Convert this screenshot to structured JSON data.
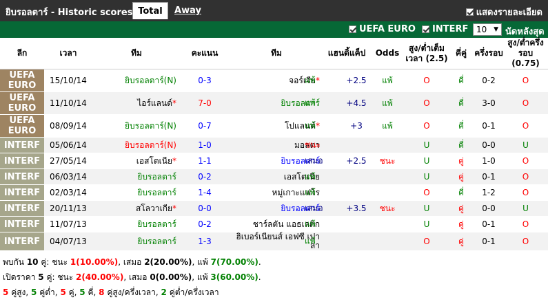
{
  "header": {
    "title": "ยิบรอลตาร์ - Historic scores",
    "tabs": {
      "total": "Total",
      "away": "Away"
    },
    "show_all_label": "แสดงรายละเอียด"
  },
  "filters": {
    "euro_label": "UEFA EURO",
    "interf_label": "INTERF",
    "count_value": "10",
    "last_label": "นัดหลังสุด"
  },
  "columns": {
    "league": "ลีก",
    "time": "เวลา",
    "home": "ทีม",
    "score": "คะแนน",
    "away": "ทีม",
    "handicap": "แฮนดิ้แค็ป",
    "odds": "Odds",
    "ou_half": "สูง/ต่ำเต็มเวลา (2.5)",
    "odd_even": "คี่คู่",
    "half": "ครึ่งรอบ",
    "ou_half2": "สูง/ต่ำครึ่งรอบ (0.75)"
  },
  "rows": [
    {
      "league": "UEFA EURO",
      "date": "15/10/14",
      "home": "ยิบรอลตาร์(N)",
      "home_color": "green",
      "home_star": false,
      "score": "0-3",
      "score_color": "blue",
      "away": "จอร์เจีย",
      "away_color": "black",
      "away_star": true,
      "result": "แพ้",
      "result_color": "green",
      "handicap": "+2.5",
      "odds": "แพ้",
      "odds_color": "green",
      "ou": "O",
      "ou_color": "red",
      "oe": "คี่",
      "oe_color": "green",
      "half": "0-2",
      "hou": "O",
      "hou_color": "red"
    },
    {
      "league": "UEFA EURO",
      "date": "11/10/14",
      "home": "ไอร์แลนด์",
      "home_color": "black",
      "home_star": true,
      "score": "7-0",
      "score_color": "red",
      "away": "ยิบรอลตาร์",
      "away_color": "green",
      "away_star": false,
      "result": "แพ้",
      "result_color": "green",
      "handicap": "+4.5",
      "odds": "แพ้",
      "odds_color": "green",
      "ou": "O",
      "ou_color": "red",
      "oe": "คี่",
      "oe_color": "green",
      "half": "3-0",
      "hou": "O",
      "hou_color": "red"
    },
    {
      "league": "UEFA EURO",
      "date": "08/09/14",
      "home": "ยิบรอลตาร์(N)",
      "home_color": "green",
      "home_star": false,
      "score": "0-7",
      "score_color": "blue",
      "away": "โปแลนด์",
      "away_color": "black",
      "away_star": true,
      "result": "แพ้",
      "result_color": "green",
      "handicap": "+3",
      "odds": "แพ้",
      "odds_color": "green",
      "ou": "O",
      "ou_color": "red",
      "oe": "คี่",
      "oe_color": "green",
      "half": "0-1",
      "hou": "O",
      "hou_color": "red"
    },
    {
      "league": "INTERF",
      "date": "05/06/14",
      "home": "ยิบรอลตาร์(N)",
      "home_color": "red",
      "home_star": false,
      "score": "1-0",
      "score_color": "blue",
      "away": "มอลตา",
      "away_color": "black",
      "away_star": false,
      "result": "ชนะ",
      "result_color": "red",
      "handicap": "",
      "odds": "",
      "odds_color": "green",
      "ou": "U",
      "ou_color": "green",
      "oe": "คี่",
      "oe_color": "green",
      "half": "0-0",
      "hou": "U",
      "hou_color": "green"
    },
    {
      "league": "INTERF",
      "date": "27/05/14",
      "home": "เอสโตเนีย",
      "home_color": "black",
      "home_star": true,
      "score": "1-1",
      "score_color": "blue",
      "away": "ยิบรอลตาร์",
      "away_color": "blue",
      "away_star": false,
      "result": "เสมอ",
      "result_color": "darkblue",
      "handicap": "+2.5",
      "odds": "ชนะ",
      "odds_color": "red",
      "ou": "U",
      "ou_color": "green",
      "oe": "คู่",
      "oe_color": "red",
      "half": "1-0",
      "hou": "O",
      "hou_color": "red"
    },
    {
      "league": "INTERF",
      "date": "06/03/14",
      "home": "ยิบรอลตาร์",
      "home_color": "green",
      "home_star": false,
      "score": "0-2",
      "score_color": "blue",
      "away": "เอสโตเนีย",
      "away_color": "black",
      "away_star": false,
      "result": "แพ้",
      "result_color": "green",
      "handicap": "",
      "odds": "",
      "odds_color": "green",
      "ou": "U",
      "ou_color": "green",
      "oe": "คู่",
      "oe_color": "red",
      "half": "0-1",
      "hou": "O",
      "hou_color": "red"
    },
    {
      "league": "INTERF",
      "date": "02/03/14",
      "home": "ยิบรอลตาร์",
      "home_color": "green",
      "home_star": false,
      "score": "1-4",
      "score_color": "blue",
      "away": "หมู่เกาะแฟโร",
      "away_color": "black",
      "away_star": false,
      "result": "แพ้",
      "result_color": "green",
      "handicap": "",
      "odds": "",
      "odds_color": "green",
      "ou": "O",
      "ou_color": "red",
      "oe": "คี่",
      "oe_color": "green",
      "half": "1-2",
      "hou": "O",
      "hou_color": "red"
    },
    {
      "league": "INTERF",
      "date": "20/11/13",
      "home": "สโลวาเกีย",
      "home_color": "black",
      "home_star": true,
      "score": "0-0",
      "score_color": "blue",
      "away": "ยิบรอลตาร์",
      "away_color": "blue",
      "away_star": false,
      "result": "เสมอ",
      "result_color": "darkblue",
      "handicap": "+3.5",
      "odds": "ชนะ",
      "odds_color": "red",
      "ou": "U",
      "ou_color": "green",
      "oe": "คู่",
      "oe_color": "red",
      "half": "0-0",
      "hou": "U",
      "hou_color": "green"
    },
    {
      "league": "INTERF",
      "date": "11/07/13",
      "home": "ยิบรอลตาร์",
      "home_color": "green",
      "home_star": false,
      "score": "0-2",
      "score_color": "blue",
      "away": "ชาร์ลตัน แอธเลติก",
      "away_color": "black",
      "away_star": false,
      "result": "แพ้",
      "result_color": "green",
      "handicap": "",
      "odds": "",
      "odds_color": "green",
      "ou": "U",
      "ou_color": "green",
      "oe": "คู่",
      "oe_color": "red",
      "half": "0-1",
      "hou": "O",
      "hou_color": "red"
    },
    {
      "league": "INTERF",
      "date": "04/07/13",
      "home": "ยิบรอลตาร์",
      "home_color": "green",
      "home_star": false,
      "score": "1-3",
      "score_color": "blue",
      "away": "ฮิเบอร์เนียนส์ เอฟซี เปา ล่า",
      "away_color": "black",
      "away_star": false,
      "result": "แพ้",
      "result_color": "green",
      "handicap": "",
      "odds": "",
      "odds_color": "green",
      "ou": "O",
      "ou_color": "red",
      "oe": "คู่",
      "oe_color": "red",
      "half": "0-1",
      "hou": "O",
      "hou_color": "red"
    }
  ],
  "summary": {
    "line1": {
      "prefix": "พบกัน",
      "n": "10",
      "a": "คู่: ชนะ",
      "w": "1",
      "wp": "(10.00%)",
      "b": ", เสมอ",
      "d": "2",
      "dp": "(20.00%)",
      "c": ", แพ้",
      "l": "7",
      "lp": "(70.00%)",
      "end": "."
    },
    "line2": {
      "prefix": "เปิดราคา",
      "n": "5",
      "a": "คู่: ชนะ",
      "w": "2",
      "wp": "(40.00%)",
      "b": ", เสมอ",
      "d": "0",
      "dp": "(0.00%)",
      "c": ", แพ้",
      "l": "3",
      "lp": "(60.00%)",
      "end": "."
    },
    "line3": {
      "o": "5",
      "ot": "คู่สูง,",
      "u": "5",
      "ut": "คู่ต่ำ,",
      "e": "5",
      "et": "คู่,",
      "od": "5",
      "odt": "คี่,",
      "ho": "8",
      "hot": "คู่สูง/ครึ่งเวลา,",
      "hu": "2",
      "hut": "คู่ต่ำ/ครึ่งเวลา"
    }
  }
}
